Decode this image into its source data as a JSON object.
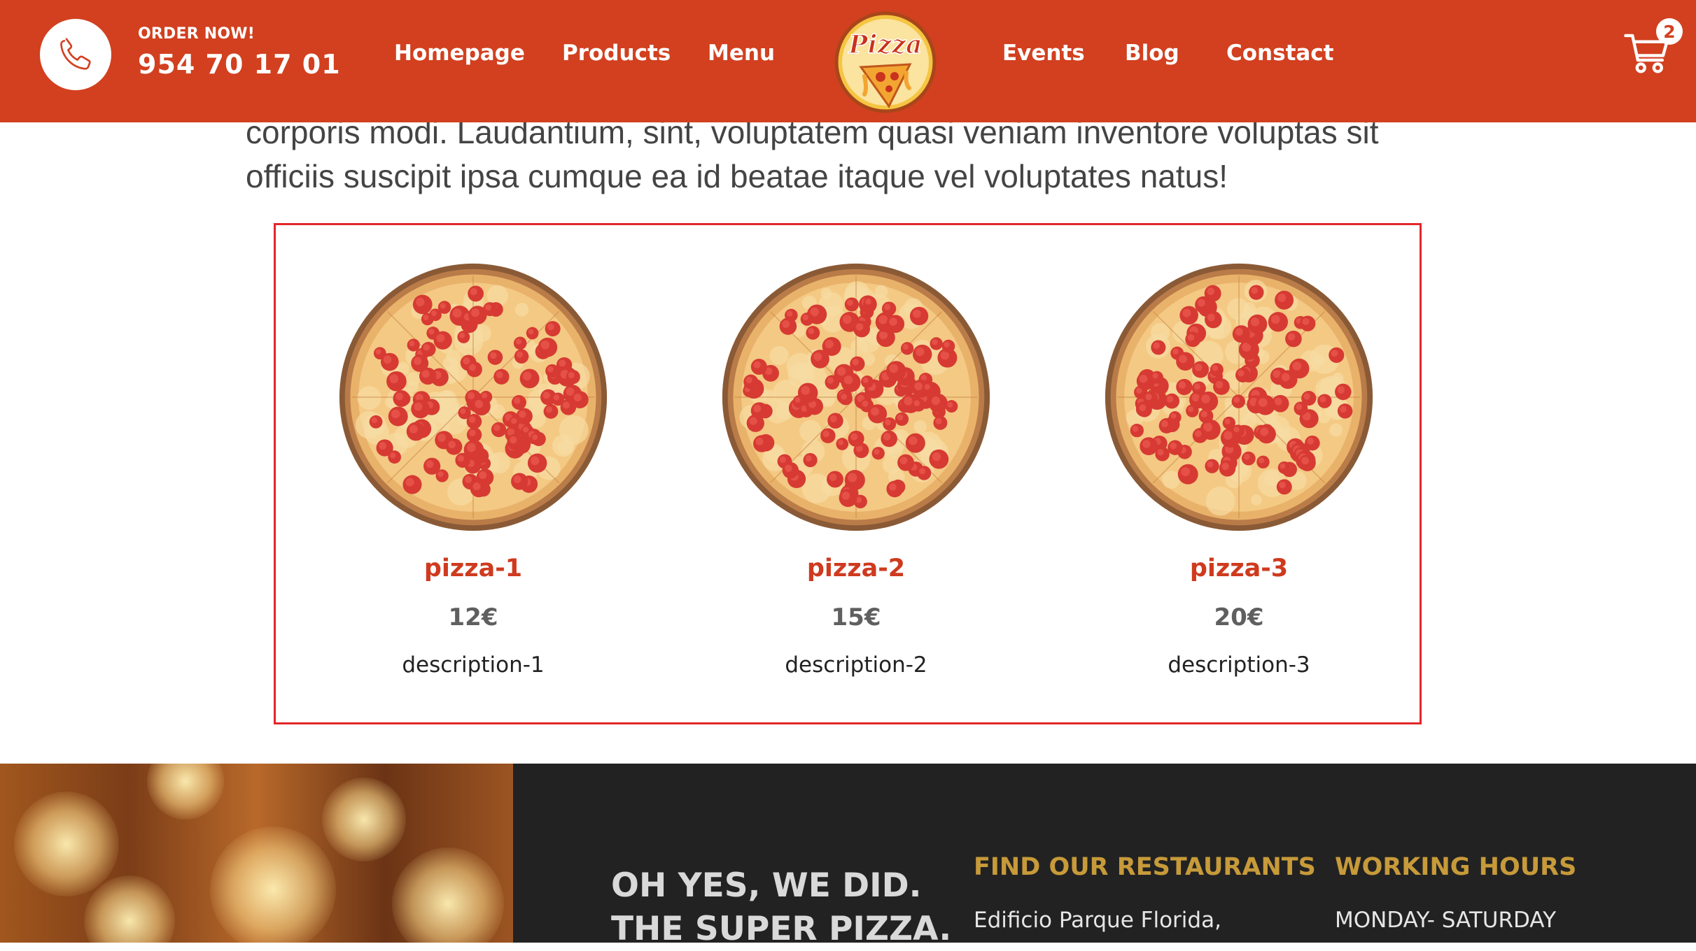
{
  "header": {
    "order_label": "ORDER NOW!",
    "phone": "954 70 17 01",
    "phone_icon": "phone-icon",
    "nav_left": [
      "Homepage",
      "Products",
      "Menu"
    ],
    "nav_right": [
      "Events",
      "Blog",
      "Constact"
    ],
    "logo_text": "Pizza",
    "cart_icon": "shopping-cart-icon",
    "cart_count": "2",
    "colors": {
      "bar": "#d2401f",
      "text": "#ffffff"
    }
  },
  "intro": {
    "line1": "corporis modi. Laudantium, sint, voluptatem quasi veniam inventore voluptas sit",
    "line2": "officiis suscipit ipsa cumque ea id beatae itaque vel voluptates natus!"
  },
  "products": [
    {
      "name": "pizza-1",
      "price": "12€",
      "description": "description-1"
    },
    {
      "name": "pizza-2",
      "price": "15€",
      "description": "description-2"
    },
    {
      "name": "pizza-3",
      "price": "20€",
      "description": "description-3"
    }
  ],
  "footer": {
    "tagline_line1": "OH YES, WE DID.",
    "tagline_line2": "THE SUPER PIZZA.",
    "restaurants_heading": "FIND OUR RESTAURANTS",
    "restaurants_text": "Edificio Parque Florida,",
    "hours_heading": "WORKING HOURS",
    "hours_text": "MONDAY- SATURDAY",
    "colors": {
      "background": "#222222",
      "heading": "#c79a3a"
    }
  }
}
